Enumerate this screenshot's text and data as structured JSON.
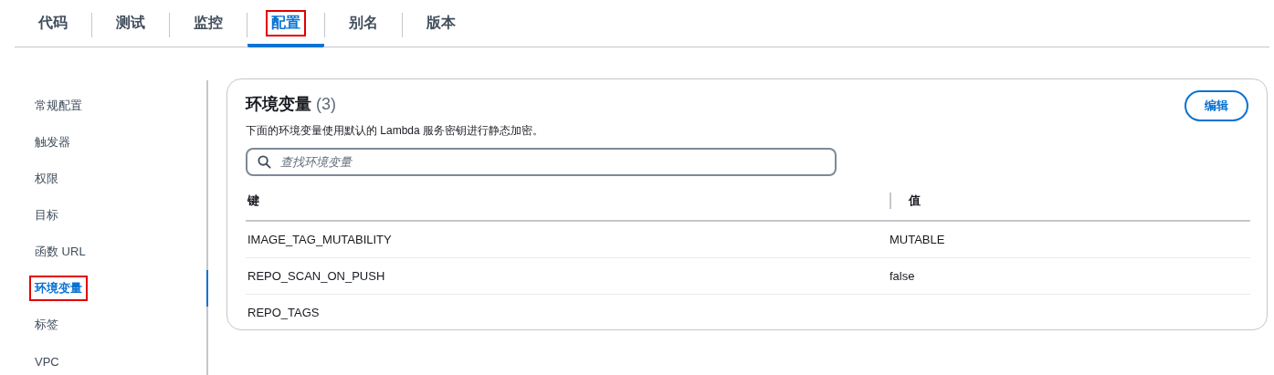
{
  "tabs": [
    {
      "label": "代码",
      "selected": false,
      "highlighted": false
    },
    {
      "label": "测试",
      "selected": false,
      "highlighted": false
    },
    {
      "label": "监控",
      "selected": false,
      "highlighted": false
    },
    {
      "label": "配置",
      "selected": true,
      "highlighted": true
    },
    {
      "label": "别名",
      "selected": false,
      "highlighted": false
    },
    {
      "label": "版本",
      "selected": false,
      "highlighted": false
    }
  ],
  "sidebar": {
    "items": [
      {
        "label": "常规配置",
        "selected": false,
        "highlighted": false
      },
      {
        "label": "触发器",
        "selected": false,
        "highlighted": false
      },
      {
        "label": "权限",
        "selected": false,
        "highlighted": false
      },
      {
        "label": "目标",
        "selected": false,
        "highlighted": false
      },
      {
        "label": "函数 URL",
        "selected": false,
        "highlighted": false
      },
      {
        "label": "环境变量",
        "selected": true,
        "highlighted": true
      },
      {
        "label": "标签",
        "selected": false,
        "highlighted": false
      },
      {
        "label": "VPC",
        "selected": false,
        "highlighted": false
      }
    ]
  },
  "panel": {
    "title": "环境变量",
    "count": "(3)",
    "edit_button": "编辑",
    "description": "下面的环境变量使用默认的 Lambda 服务密钥进行静态加密。",
    "search": {
      "placeholder": "查找环境变量"
    },
    "table": {
      "columns": [
        "键",
        "值"
      ],
      "rows": [
        {
          "key": "IMAGE_TAG_MUTABILITY",
          "value": "MUTABLE"
        },
        {
          "key": "REPO_SCAN_ON_PUSH",
          "value": "false"
        },
        {
          "key": "REPO_TAGS"
        }
      ]
    }
  }
}
